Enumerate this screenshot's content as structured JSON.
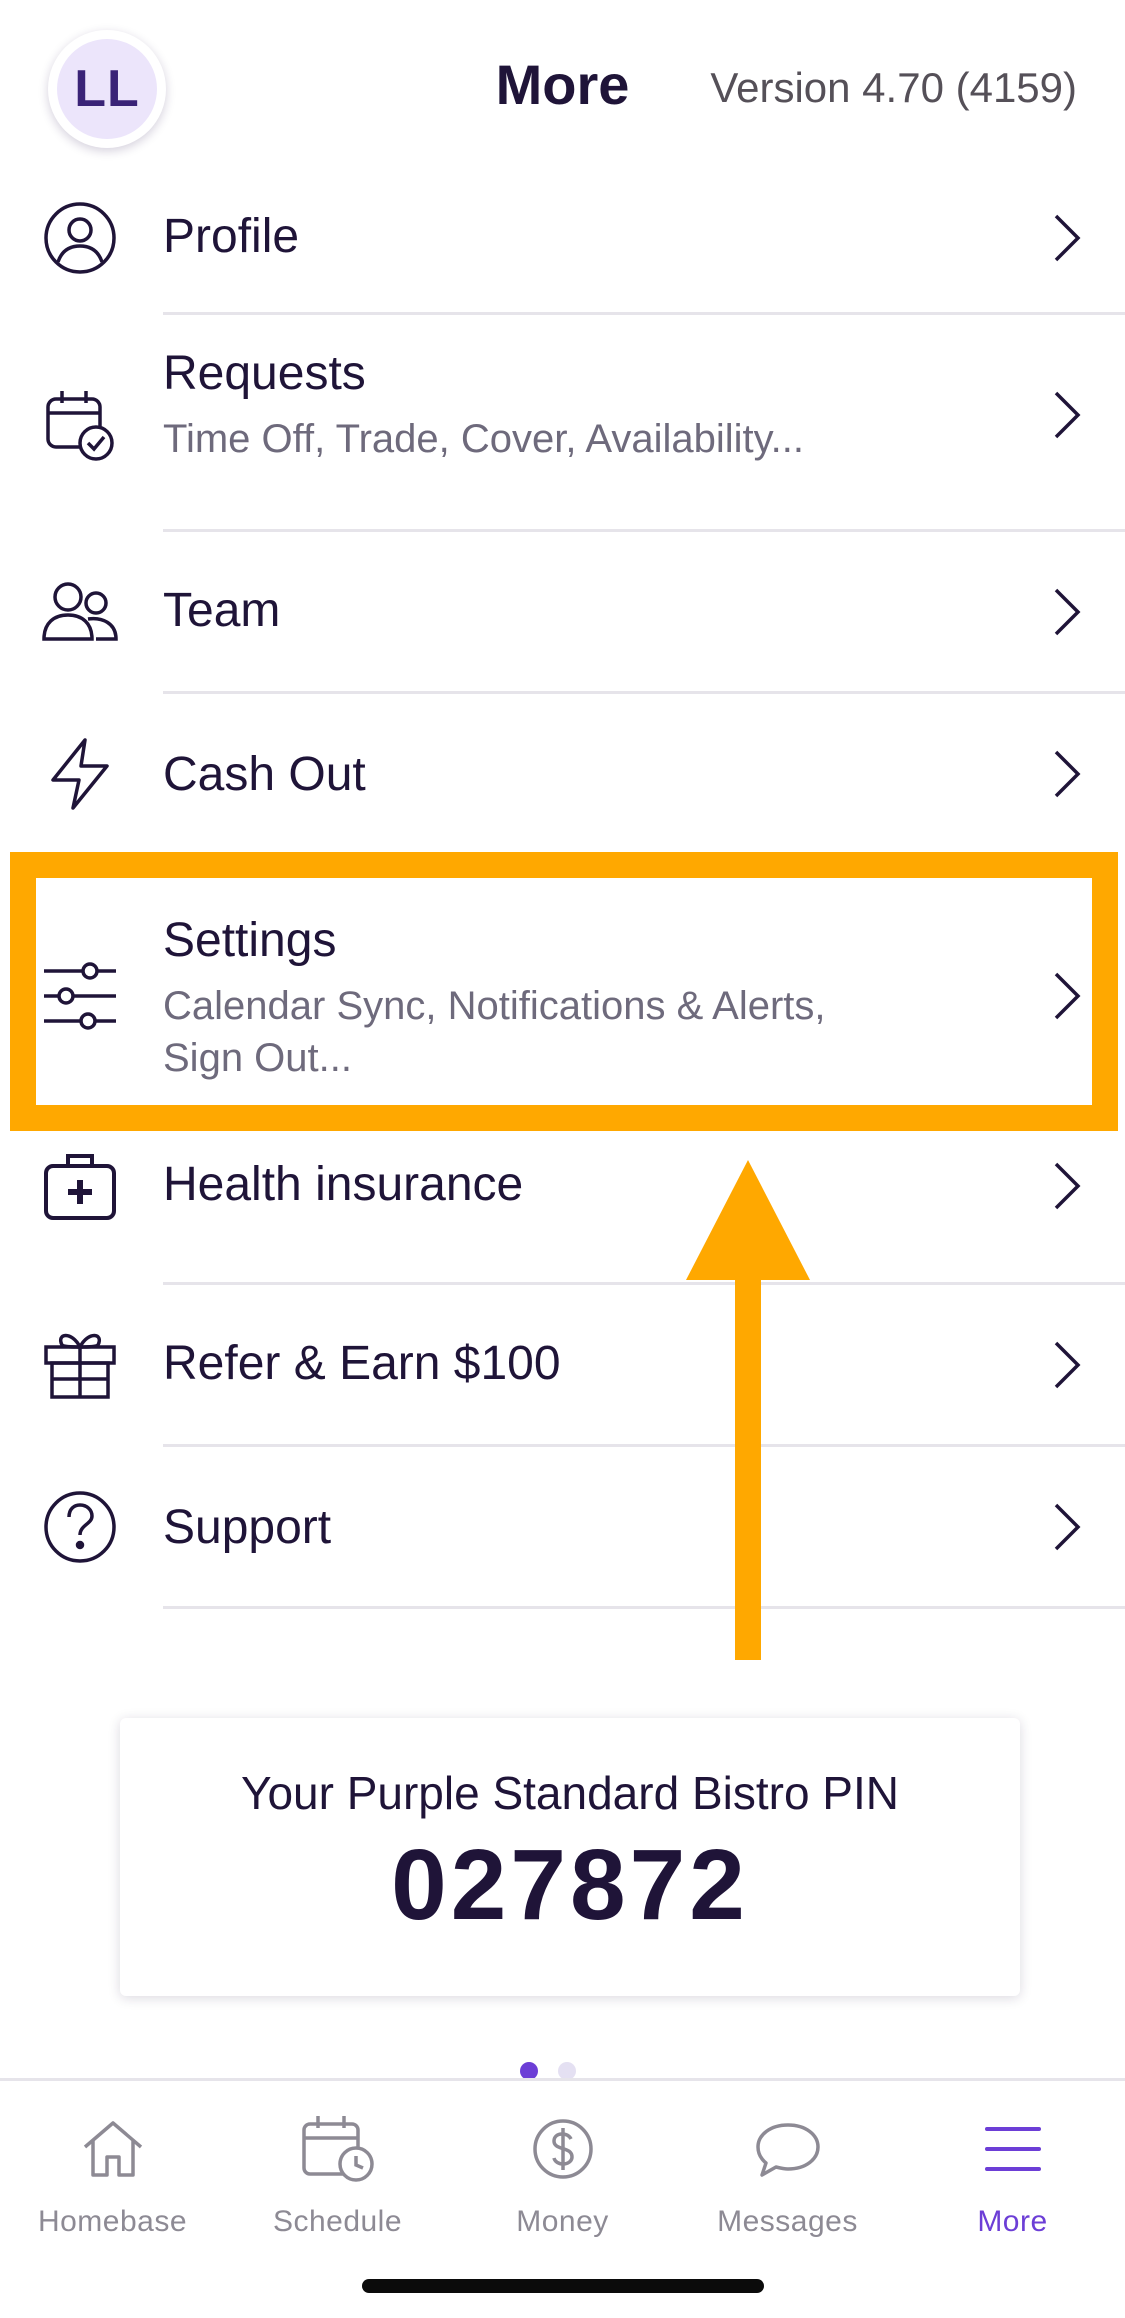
{
  "header": {
    "avatar_initials": "LL",
    "title": "More",
    "version": "Version 4.70 (4159)"
  },
  "menu": {
    "items": [
      {
        "label": "Profile",
        "icon": "person-icon"
      },
      {
        "label": "Requests",
        "sub": "Time Off, Trade, Cover, Availability...",
        "icon": "calendar-check-icon"
      },
      {
        "label": "Team",
        "icon": "people-icon"
      },
      {
        "label": "Cash Out",
        "icon": "lightning-icon"
      },
      {
        "label": "Settings",
        "sub1": "Calendar Sync, Notifications & Alerts,",
        "sub2": "Sign Out...",
        "icon": "sliders-icon"
      },
      {
        "label": "Health insurance",
        "icon": "medical-kit-icon"
      },
      {
        "label": "Refer & Earn $100",
        "icon": "gift-icon"
      },
      {
        "label": "Support",
        "icon": "question-icon"
      }
    ]
  },
  "pin": {
    "label": "Your Purple Standard Bistro PIN",
    "value": "027872"
  },
  "pager": {
    "pages": 2,
    "active": 1
  },
  "tabbar": {
    "tabs": [
      {
        "label": "Homebase",
        "icon": "home-icon"
      },
      {
        "label": "Schedule",
        "icon": "calendar-clock-icon"
      },
      {
        "label": "Money",
        "icon": "dollar-icon"
      },
      {
        "label": "Messages",
        "icon": "chat-icon"
      },
      {
        "label": "More",
        "icon": "menu-icon"
      }
    ],
    "active": "More"
  },
  "colors": {
    "text_primary": "#1f1438",
    "text_secondary": "#6e6a7c",
    "accent_purple": "#6c3ed6",
    "highlight_orange": "#ffa800",
    "tab_inactive": "#8d8a94"
  }
}
